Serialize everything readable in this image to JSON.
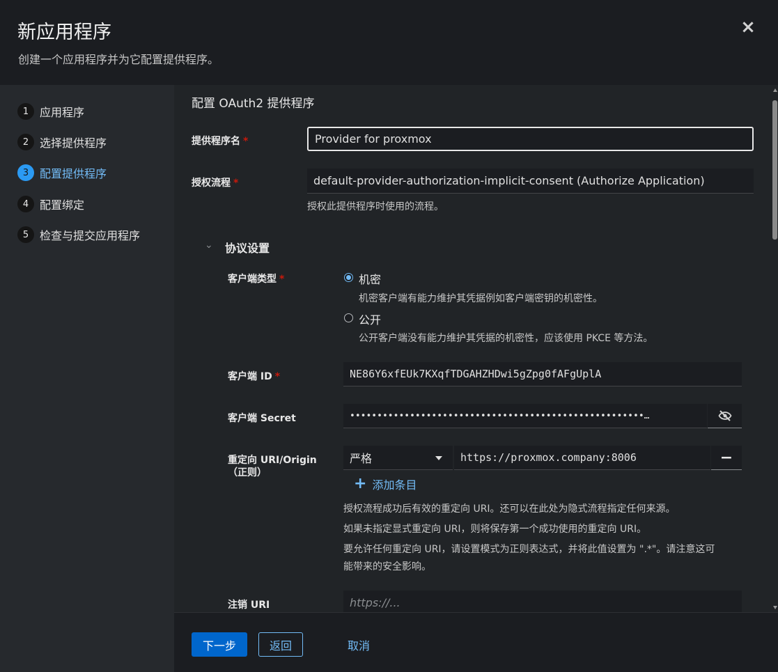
{
  "header": {
    "title": "新应用程序",
    "subtitle": "创建一个应用程序并为它配置提供程序。",
    "close_icon": "×"
  },
  "nav": {
    "items": [
      {
        "num": "1",
        "label": "应用程序"
      },
      {
        "num": "2",
        "label": "选择提供程序"
      },
      {
        "num": "3",
        "label": "配置提供程序"
      },
      {
        "num": "4",
        "label": "配置绑定"
      },
      {
        "num": "5",
        "label": "检查与提交应用程序"
      }
    ]
  },
  "form": {
    "section_title": "配置 OAuth2 提供程序",
    "provider_name": {
      "label": "提供程序名",
      "required": "*",
      "value": "Provider for proxmox"
    },
    "auth_flow": {
      "label": "授权流程",
      "required": "*",
      "value": "default-provider-authorization-implicit-consent (Authorize Application)",
      "help": "授权此提供程序时使用的流程。"
    },
    "protocol": {
      "title": "协议设置",
      "chevron": "⌄",
      "client_type": {
        "label": "客户端类型",
        "required": "*",
        "options": [
          {
            "label": "机密",
            "help": "机密客户端有能力维护其凭据例如客户端密钥的机密性。"
          },
          {
            "label": "公开",
            "help": "公开客户端没有能力维护其凭据的机密性，应该使用 PKCE 等方法。"
          }
        ]
      },
      "client_id": {
        "label": "客户端 ID",
        "required": "*",
        "value": "NE86Y6xfEUk7KXqfTDGAHZHDwi5gZpg0fAFgUplA"
      },
      "client_secret": {
        "label": "客户端 Secret",
        "value": "••••••••••••••••••••••••••••••••••••••••••••••••••••••…"
      },
      "redirect": {
        "label_line1": "重定向 URI/Origin",
        "label_line2": "（正则）",
        "mode": "严格",
        "url": "https://proxmox.company:8006",
        "remove": "−",
        "add_label": "添加条目",
        "add_icon": "+",
        "help1": "授权流程成功后有效的重定向 URI。还可以在此处为隐式流程指定任何来源。",
        "help2": "如果未指定显式重定向 URI，则将保存第一个成功使用的重定向 URI。",
        "help3a": "要允许任何重定向 URI，请设置模式为正则表达式，并将此值设置为 \".*\"。请注意这可",
        "help3b": "能带来的安全影响。"
      },
      "logout": {
        "label": "注销 URI",
        "placeholder": "https://..."
      }
    }
  },
  "footer": {
    "next": "下一步",
    "back": "返回",
    "cancel": "取消"
  },
  "colors": {
    "accent": "#73bcf7",
    "primary": "#0066cc",
    "required": "#c9190b"
  }
}
